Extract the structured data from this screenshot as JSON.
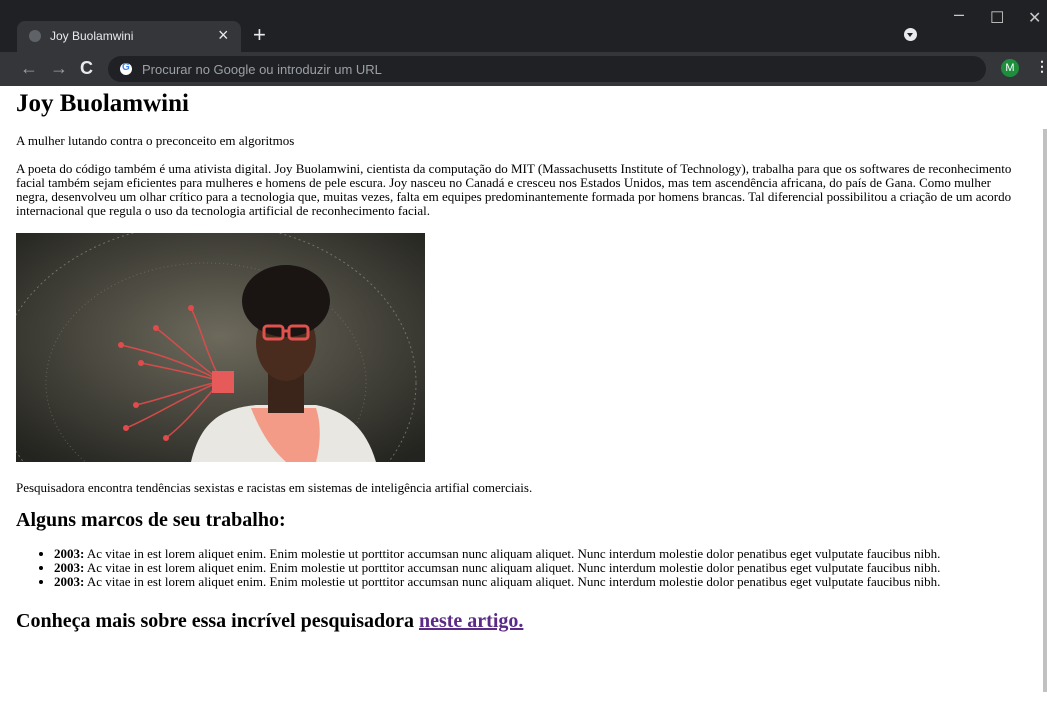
{
  "browser": {
    "tab_title": "Joy Buolamwini",
    "tab_close": "×",
    "new_tab": "+",
    "window": {
      "minimize": "–",
      "maximize": "☐",
      "close": "✕"
    },
    "nav": {
      "back": "←",
      "forward": "→",
      "reload": "C"
    },
    "omnibox_placeholder": "Procurar no Google ou introduzir um URL",
    "profile_initial": "M",
    "menu": "⋮"
  },
  "article": {
    "title": "Joy Buolamwini",
    "subtitle": "A mulher lutando contra o preconceito em algoritmos",
    "intro": "A poeta do código também é uma ativista digital. Joy Buolamwini, cientista da computação do MIT (Massachusetts Institute of Technology), trabalha para que os softwares de reconhecimento facial também sejam eficientes para mulheres e homens de pele escura. Joy nasceu no Canadá e cresceu nos Estados Unidos, mas tem ascendência africana, do país de Gana. Como mulher negra, desenvolveu um olhar crítico para a tecnologia que, muitas vezes, falta em equipes predominantemente formada por homens brancas. Tal diferencial possibilitou a criação de um acordo internacional que regula o uso da tecnologia artificial de reconhecimento facial.",
    "image_caption": "Pesquisadora encontra tendências sexistas e racistas em sistemas de inteligência artifial comerciais.",
    "milestones_heading": "Alguns marcos de seu trabalho:",
    "milestones": [
      {
        "year": "2003:",
        "text": " Ac vitae in est lorem aliquet enim. Enim molestie ut porttitor accumsan nunc aliquam aliquet. Nunc interdum molestie dolor penatibus eget vulputate faucibus nibh."
      },
      {
        "year": "2003:",
        "text": " Ac vitae in est lorem aliquet enim. Enim molestie ut porttitor accumsan nunc aliquam aliquet. Nunc interdum molestie dolor penatibus eget vulputate faucibus nibh."
      },
      {
        "year": "2003:",
        "text": " Ac vitae in est lorem aliquet enim. Enim molestie ut porttitor accumsan nunc aliquam aliquet. Nunc interdum molestie dolor penatibus eget vulputate faucibus nibh."
      }
    ],
    "more_text": "Conheça mais sobre essa incrível pesquisadora ",
    "more_link": "neste artigo."
  },
  "colors": {
    "visited_link": "#5b2a86",
    "chrome_dark": "#202124",
    "chrome_tab": "#35363a",
    "profile": "#1e8e3e"
  }
}
